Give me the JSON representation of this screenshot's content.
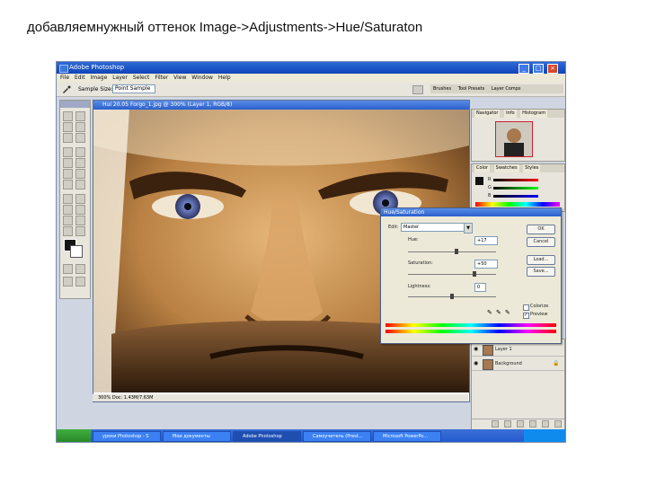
{
  "caption": "добавляемнужный оттенок Image->Adjustments->Hue/Saturaton",
  "app": {
    "title": "Adobe Photoshop",
    "menu": [
      "File",
      "Edit",
      "Image",
      "Layer",
      "Select",
      "Filter",
      "View",
      "Window",
      "Help"
    ],
    "options": {
      "sample_label": "Sample Size:",
      "sample_value": "Point Sample"
    },
    "panel_tabs_top": [
      "Brushes",
      "Tool Presets",
      "Layer Comps"
    ]
  },
  "document": {
    "title": "Hui 20.05 Forgo_1.jpg @ 300% (Layer 1, RGB/8)",
    "status": "300%   Doc: 1.43M/7.63M"
  },
  "navigator": {
    "tabs": [
      "Navigator",
      "Info",
      "Histogram"
    ]
  },
  "color_panel": {
    "tabs": [
      "Color",
      "Swatches",
      "Styles"
    ],
    "channels": [
      "R",
      "G",
      "B"
    ]
  },
  "layers": {
    "items": [
      "Layer 1",
      "Background"
    ]
  },
  "hue_sat": {
    "title": "Hue/Saturation",
    "edit_label": "Edit:",
    "edit_value": "Master",
    "hue_label": "Hue:",
    "hue_value": "+17",
    "sat_label": "Saturation:",
    "sat_value": "+50",
    "light_label": "Lightness:",
    "light_value": "0",
    "buttons": {
      "ok": "OK",
      "cancel": "Cancel",
      "load": "Load...",
      "save": "Save..."
    },
    "colorize_label": "Colorize",
    "preview_label": "Preview",
    "colorize": false,
    "preview": true,
    "hue_level": 0.55,
    "sat_level": 0.75,
    "light_level": 0.5
  },
  "taskbar": {
    "items": [
      "уроки Photoshop - S",
      "Мои документы",
      "Adobe Photoshop",
      "Самоучитель (Prest...",
      "Microsoft PowerPo..."
    ]
  }
}
